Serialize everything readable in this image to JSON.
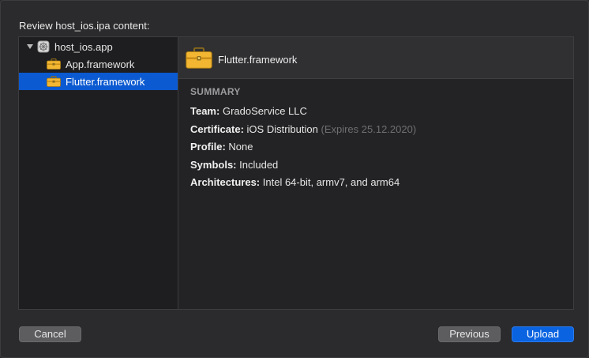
{
  "dialog": {
    "heading": "Review host_ios.ipa content:"
  },
  "outline": {
    "items": [
      {
        "label": "host_ios.app",
        "icon": "app-bundle-icon",
        "expanded": true,
        "selected": false,
        "level": 0
      },
      {
        "label": "App.framework",
        "icon": "briefcase-icon",
        "selected": false,
        "level": 1
      },
      {
        "label": "Flutter.framework",
        "icon": "briefcase-icon",
        "selected": true,
        "level": 1
      }
    ]
  },
  "detail": {
    "title": "Flutter.framework",
    "icon": "briefcase-icon",
    "summary_heading": "SUMMARY",
    "team_key": "Team:",
    "team_value": "GradoService LLC",
    "certificate_key": "Certificate:",
    "certificate_value": "iOS Distribution",
    "certificate_expiry": "(Expires 25.12.2020)",
    "profile_key": "Profile:",
    "profile_value": "None",
    "symbols_key": "Symbols:",
    "symbols_value": "Included",
    "architectures_key": "Architectures:",
    "architectures_value": "Intel 64-bit, armv7, and arm64"
  },
  "buttons": {
    "cancel": "Cancel",
    "previous": "Previous",
    "upload": "Upload"
  },
  "colors": {
    "selection": "#0b5ad1",
    "primary_button": "#0a63e0",
    "briefcase": "#f2b632"
  }
}
